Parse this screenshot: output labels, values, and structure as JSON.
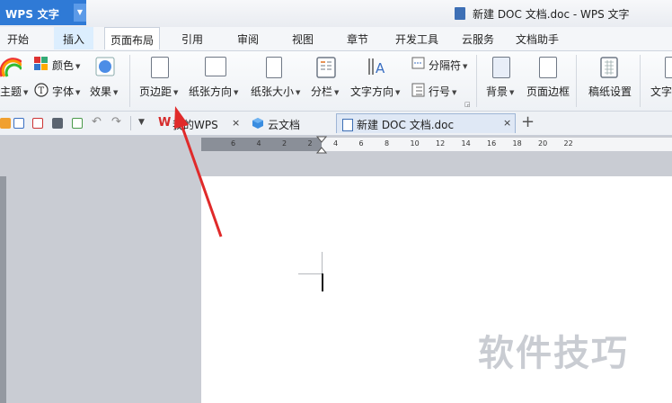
{
  "app": {
    "name": "WPS 文字",
    "window_title": "新建 DOC 文档.doc - WPS 文字"
  },
  "menu_tabs": [
    "开始",
    "插入",
    "页面布局",
    "引用",
    "审阅",
    "视图",
    "章节",
    "开发工具",
    "云服务",
    "文档助手"
  ],
  "active_tab": "页面布局",
  "ribbon": {
    "theme": "主题",
    "color": "颜色",
    "font": "字体",
    "effect": "效果",
    "margins": "页边距",
    "orientation": "纸张方向",
    "paper_size": "纸张大小",
    "columns": "分栏",
    "text_direction": "文字方向",
    "breaks": "分隔符",
    "line_numbers": "行号",
    "background": "背景",
    "page_border": "页面边框",
    "grid_paper": "稿纸设置",
    "wrap_text": "文字"
  },
  "doc_tabs": [
    {
      "label": "我的WPS",
      "closable": true
    },
    {
      "label": "云文档",
      "closable": false
    },
    {
      "label": "新建 DOC 文档.doc",
      "closable": true,
      "active": true
    }
  ],
  "ruler_labels": [
    "6",
    "4",
    "2",
    "2",
    "4",
    "6",
    "8",
    "10",
    "12",
    "14",
    "16",
    "18",
    "20",
    "22"
  ],
  "watermark": "软件技巧",
  "colors": {
    "app_blue": "#2f7ad6",
    "arrow_red": "#e02a2a",
    "ruler_gray": "#8a8f98"
  },
  "icons": [
    "theme-icon",
    "color-palette-icon",
    "font-icon",
    "effect-icon",
    "margins-icon",
    "orientation-icon",
    "paper-size-icon",
    "columns-icon",
    "text-direction-icon",
    "breaks-icon",
    "line-numbers-icon",
    "background-icon",
    "page-border-icon",
    "grid-paper-icon",
    "folder-icon",
    "save-icon",
    "pdf-icon",
    "print-icon",
    "print-preview-icon",
    "undo-icon",
    "redo-icon",
    "cloud-icon",
    "new-tab-icon"
  ]
}
